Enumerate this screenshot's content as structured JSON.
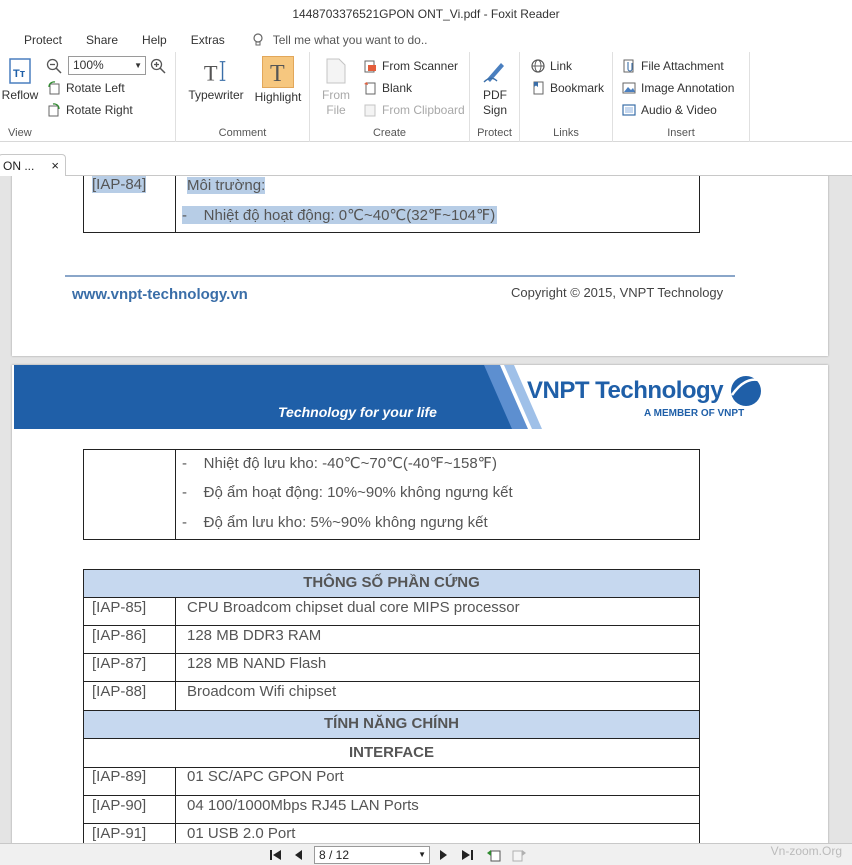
{
  "window": {
    "title": "1448703376521GPON ONT_Vi.pdf - Foxit Reader"
  },
  "menu": {
    "items": [
      "Protect",
      "Share",
      "Help",
      "Extras"
    ],
    "tellme_placeholder": "Tell me what you want to do.."
  },
  "ribbon": {
    "view": {
      "label": "View",
      "reflow": "Reflow",
      "zoom_value": "100%",
      "rotate_left": "Rotate Left",
      "rotate_right": "Rotate Right"
    },
    "comment": {
      "label": "Comment",
      "typewriter": "Typewriter",
      "highlight": "Highlight"
    },
    "create": {
      "label": "Create",
      "from_file_1": "From",
      "from_file_2": "File",
      "from_scanner": "From Scanner",
      "blank": "Blank",
      "from_clipboard": "From Clipboard"
    },
    "protect": {
      "label": "Protect",
      "pdf_sign_1": "PDF",
      "pdf_sign_2": "Sign"
    },
    "links": {
      "label": "Links",
      "link": "Link",
      "bookmark": "Bookmark"
    },
    "insert": {
      "label": "Insert",
      "file_attachment": "File Attachment",
      "image_annotation": "Image Annotation",
      "audio_video": "Audio & Video"
    }
  },
  "doc_tab": {
    "label": "ON ...",
    "close": "×"
  },
  "page_top": {
    "row": {
      "id": "[IAP-84]",
      "title": "Môi trường:",
      "bullet": "Nhiệt độ hoạt động: 0℃~40℃(32℉~104℉)"
    },
    "footer_link": "www.vnpt-technology.vn",
    "footer_copy": "Copyright © 2015, VNPT Technology"
  },
  "page_bottom": {
    "header": {
      "tagline": "Technology for your life",
      "brand": "VNPT Technology",
      "member": "A MEMBER OF VNPT"
    },
    "bullets": [
      "Nhiệt độ lưu kho: -40℃~70℃(-40℉~158℉)",
      "Độ ẩm hoạt động: 10%~90% không ngưng kết",
      "Độ ẩm lưu kho: 5%~90% không ngưng kết"
    ],
    "hw_title": "THÔNG SỐ PHẦN CỨNG",
    "hw_rows": [
      {
        "id": "[IAP-85]",
        "text": "CPU Broadcom chipset dual core MIPS processor"
      },
      {
        "id": "[IAP-86]",
        "text": "128 MB DDR3 RAM"
      },
      {
        "id": "[IAP-87]",
        "text": "128 MB NAND Flash"
      },
      {
        "id": "[IAP-88]",
        "text": "Broadcom Wifi chipset"
      }
    ],
    "feature_title": "TÍNH NĂNG CHÍNH",
    "interface_title": "INTERFACE",
    "if_rows": [
      {
        "id": "[IAP-89]",
        "text": "01 SC/APC GPON Port"
      },
      {
        "id": "[IAP-90]",
        "text": "04 100/1000Mbps RJ45 LAN Ports"
      },
      {
        "id": "[IAP-91]",
        "text": "01 USB 2.0 Port"
      }
    ]
  },
  "nav": {
    "page_value": "8 / 12",
    "watermark": "Vn-zoom.Org"
  },
  "colors": {
    "brand_blue": "#1f5fa8",
    "table_head": "#c6d8ef",
    "accent": "#f5a623"
  }
}
